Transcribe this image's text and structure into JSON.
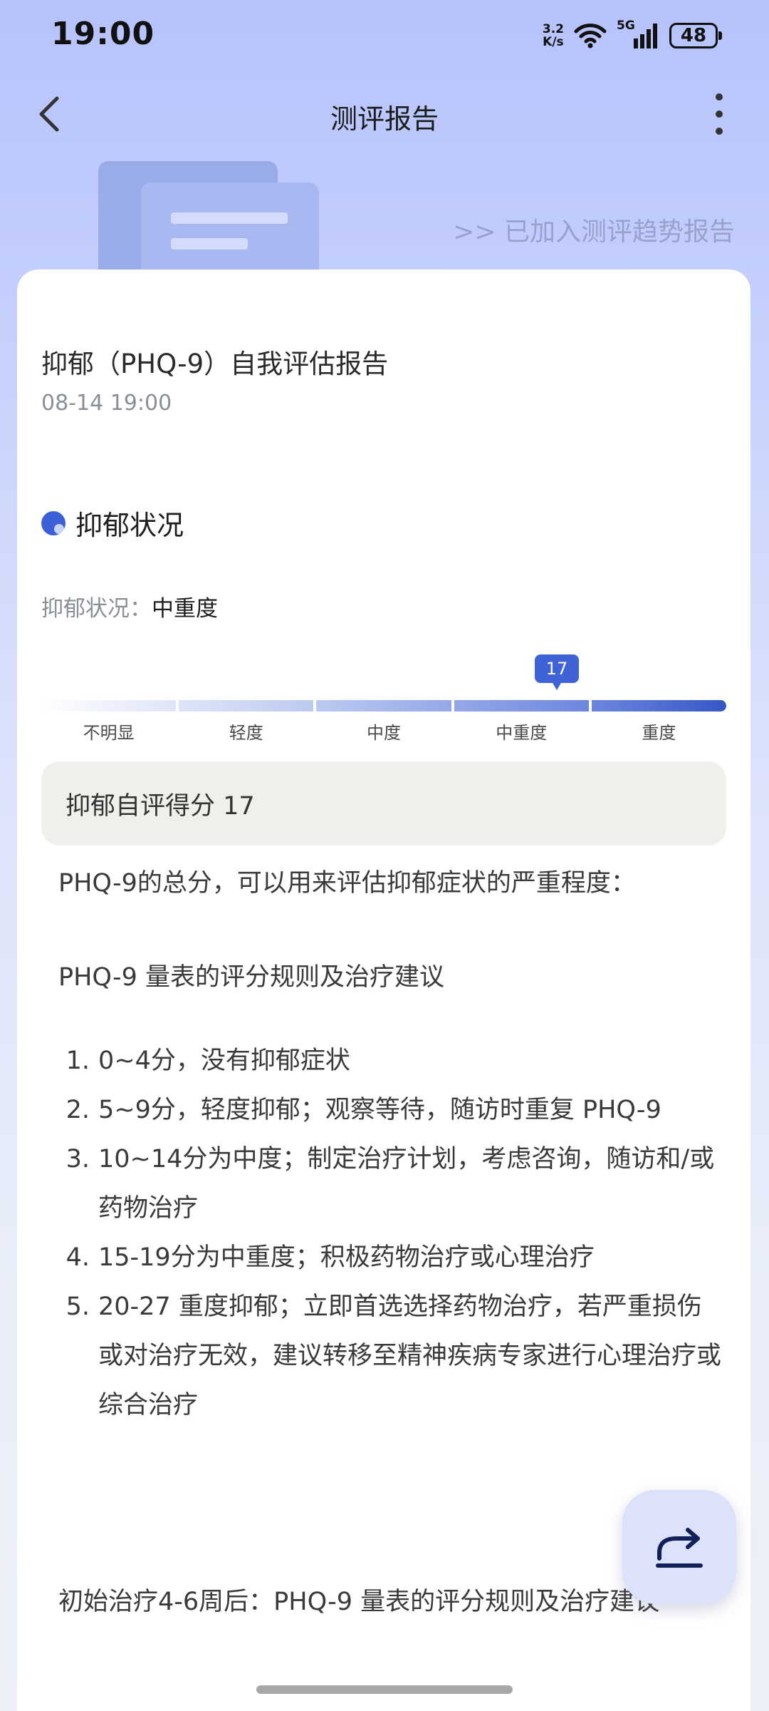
{
  "status_bar": {
    "time": "19:00",
    "net_speed_value": "3.2",
    "net_speed_unit": "K/s",
    "network": "5G",
    "battery": "48",
    "icons": [
      "wifi-icon",
      "signal-icon",
      "battery-icon"
    ]
  },
  "nav": {
    "title": "测评报告",
    "icons": [
      "back-icon",
      "more-icon"
    ]
  },
  "header": {
    "trend_link": ">> 已加入测评趋势报告"
  },
  "report": {
    "title": "抑郁（PHQ-9）自我评估报告",
    "date": "08-14 19:00",
    "section_title": "抑郁状况",
    "status_label": "抑郁状况：",
    "status_value": "中重度",
    "severity": {
      "score": "17",
      "levels": [
        "不明显",
        "轻度",
        "中度",
        "中重度",
        "重度"
      ]
    },
    "score_text": "抑郁自评得分 17",
    "intro": "PHQ-9的总分，可以用来评估抑郁症状的严重程度：",
    "rules_title": "PHQ-9 量表的评分规则及治疗建议",
    "rules": [
      "0~4分，没有抑郁症状",
      "5~9分，轻度抑郁；观察等待，随访时重复 PHQ-9",
      "10~14分为中度；制定治疗计划，考虑咨询，随访和/或药物治疗",
      "15-19分为中重度；积极药物治疗或心理治疗",
      "20-27 重度抑郁；立即首选选择药物治疗，若严重损伤或对治疗无效，建议转移至精神疾病专家进行心理治疗或综合治疗"
    ],
    "after_text": "初始治疗4-6周后：PHQ-9 量表的评分规则及治疗建议"
  },
  "fab": {
    "icon": "share-icon"
  },
  "colors": {
    "accent": "#3f63d6",
    "background_top": "#b6c3fb",
    "card": "#ffffff",
    "score_box": "#eef0ec"
  }
}
